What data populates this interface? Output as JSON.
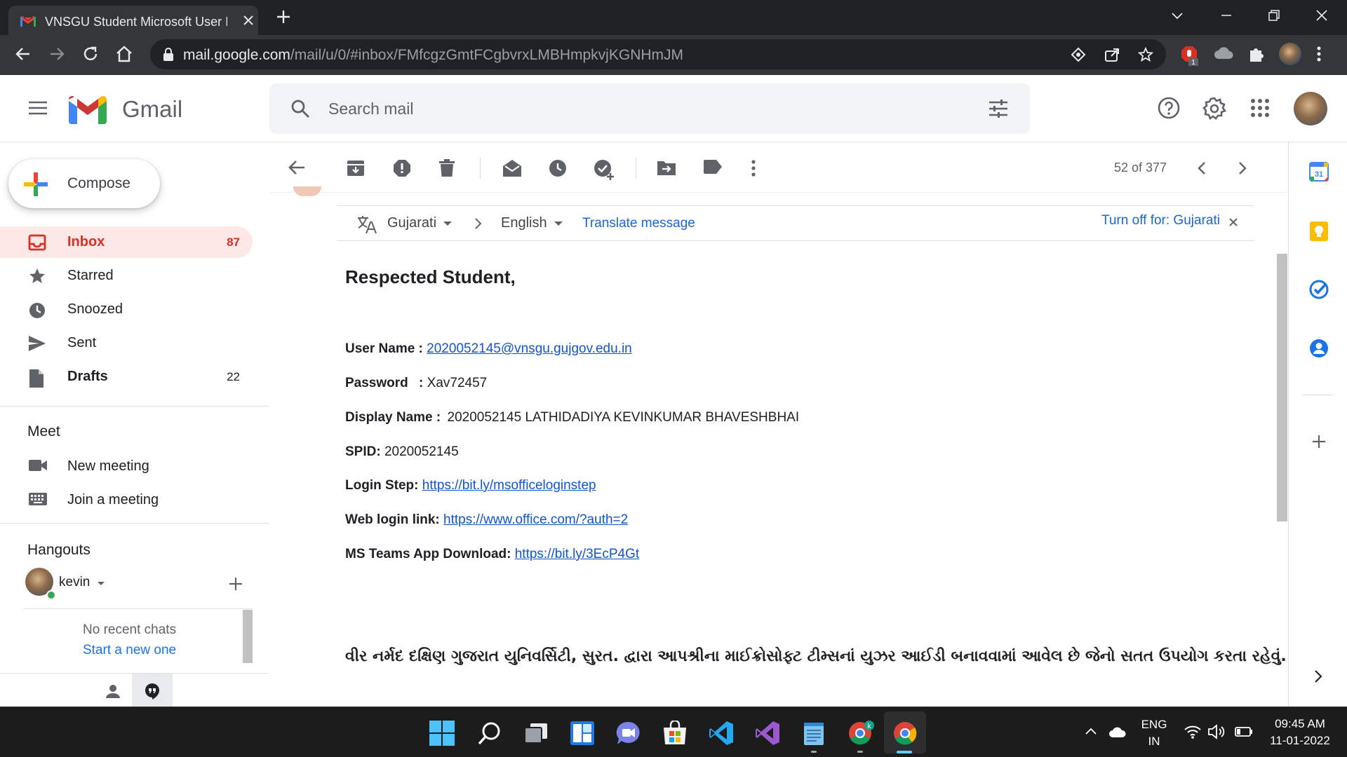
{
  "browser": {
    "tab_title": "VNSGU Student Microsoft User ID",
    "url_host": "mail.google.com",
    "url_path": "/mail/u/0/#inbox/FMfcgzGmtFCgbvrxLMBHmpkvjKGNHmJM",
    "extension_badge": "1"
  },
  "gmail": {
    "logo_text": "Gmail",
    "search_placeholder": "Search mail",
    "compose_label": "Compose",
    "nav": [
      {
        "label": "Inbox",
        "count": "87"
      },
      {
        "label": "Starred",
        "count": ""
      },
      {
        "label": "Snoozed",
        "count": ""
      },
      {
        "label": "Sent",
        "count": ""
      },
      {
        "label": "Drafts",
        "count": "22"
      }
    ],
    "meet": {
      "title": "Meet",
      "new_meeting": "New meeting",
      "join_meeting": "Join a meeting"
    },
    "hangouts": {
      "title": "Hangouts",
      "user": "kevin",
      "no_chats": "No recent chats",
      "start_new": "Start a new one"
    },
    "pager": "52 of 377",
    "translate": {
      "from_lang": "Gujarati",
      "to_lang": "English",
      "translate_link": "Translate message",
      "turn_off": "Turn off for: Gujarati"
    },
    "email": {
      "greeting": "Respected Student,",
      "username_label": "User Name :",
      "username_value": "2020052145@vnsgu.gujgov.edu.in",
      "password_label": "Password",
      "password_sep": ":",
      "password_value": "Xav72457",
      "display_label": "Display Name :",
      "display_value": "2020052145 LATHIDADIYA KEVINKUMAR BHAVESHBHAI",
      "spid_label": "SPID:",
      "spid_value": "2020052145",
      "login_step_label": "Login Step:",
      "login_step_link": "https://bit.ly/msofficeloginstep",
      "web_login_label": "Web login link:",
      "web_login_link": "https://www.office.com/?auth=2",
      "teams_label": "MS Teams App Download:",
      "teams_link": "https://bit.ly/3EcP4Gt",
      "gujarati_line": "વીર નર્મદ દક્ષિણ ગુજરાત યુનિવર્સિટી, સુરત. દ્વારા આપશ્રીના માઈક્રોસોફ્ટ ટીમ્સનાં યુઝર આઈડી બનાવવામાં આવેલ છે જેનો સતત ઉપયોગ કરતા રહેવું."
    }
  },
  "taskbar": {
    "lang_top": "ENG",
    "lang_bottom": "IN",
    "time": "09:45 AM",
    "date": "11-01-2022"
  },
  "colors": {
    "gmail_red": "#d93025",
    "link_blue": "#1155cc",
    "chrome_dark": "#202124"
  }
}
